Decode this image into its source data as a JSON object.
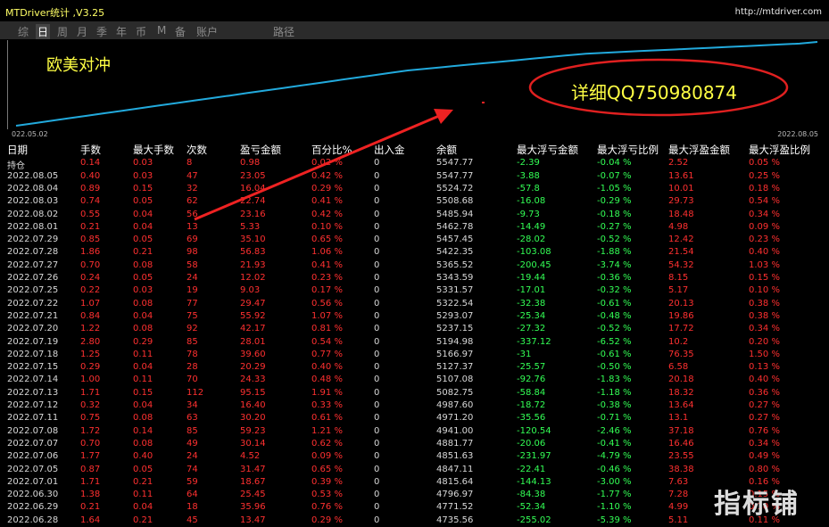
{
  "titlebar": {
    "title": "MTDriver统计 ,V3.25",
    "url": "http://mtdriver.com"
  },
  "nav": {
    "items": [
      "综",
      "日",
      "周",
      "月",
      "季",
      "年",
      "币",
      "M",
      "备",
      "账户",
      "路径"
    ],
    "active_index": 1
  },
  "chart": {
    "title": "欧美对冲",
    "ad_text": "详细QQ750980874",
    "date_start": "022.05.02",
    "date_end": "2022.08.05"
  },
  "chart_data": {
    "type": "line",
    "series": [
      {
        "values": [
          0.0,
          0.03,
          0.06,
          0.09,
          0.12,
          0.15,
          0.18,
          0.21,
          0.24,
          0.27,
          0.3,
          0.33,
          0.36,
          0.39,
          0.42,
          0.45,
          0.48,
          0.51,
          0.54,
          0.57,
          0.6,
          0.63,
          0.66,
          0.68,
          0.7,
          0.72,
          0.74,
          0.76,
          0.78,
          0.8,
          0.82,
          0.84,
          0.86,
          0.87,
          0.88,
          0.89,
          0.9,
          0.91,
          0.92,
          0.93,
          0.94,
          0.95,
          0.96,
          0.97,
          0.98,
          1.0
        ]
      }
    ],
    "line_color": "#22aadd"
  },
  "table": {
    "headers": [
      "日期",
      "手数",
      "最大手数",
      "次数",
      "盈亏金额",
      "百分比%",
      "出入金",
      "余额",
      "最大浮亏金额",
      "最大浮亏比例",
      "最大浮盈金额",
      "最大浮盈比例"
    ],
    "rows": [
      [
        "持仓",
        "0.14",
        "0.03",
        "8",
        "0.98",
        "0.02 %",
        "0",
        "5547.77",
        "-2.39",
        "-0.04 %",
        "2.52",
        "0.05 %"
      ],
      [
        "2022.08.05",
        "0.40",
        "0.03",
        "47",
        "23.05",
        "0.42 %",
        "0",
        "5547.77",
        "-3.88",
        "-0.07 %",
        "13.61",
        "0.25 %"
      ],
      [
        "2022.08.04",
        "0.89",
        "0.15",
        "32",
        "16.04",
        "0.29 %",
        "0",
        "5524.72",
        "-57.8",
        "-1.05 %",
        "10.01",
        "0.18 %"
      ],
      [
        "2022.08.03",
        "0.74",
        "0.05",
        "62",
        "22.74",
        "0.41 %",
        "0",
        "5508.68",
        "-16.08",
        "-0.29 %",
        "29.73",
        "0.54 %"
      ],
      [
        "2022.08.02",
        "0.55",
        "0.04",
        "56",
        "23.16",
        "0.42 %",
        "0",
        "5485.94",
        "-9.73",
        "-0.18 %",
        "18.48",
        "0.34 %"
      ],
      [
        "2022.08.01",
        "0.21",
        "0.04",
        "13",
        "5.33",
        "0.10 %",
        "0",
        "5462.78",
        "-14.49",
        "-0.27 %",
        "4.98",
        "0.09 %"
      ],
      [
        "2022.07.29",
        "0.85",
        "0.05",
        "69",
        "35.10",
        "0.65 %",
        "0",
        "5457.45",
        "-28.02",
        "-0.52 %",
        "12.42",
        "0.23 %"
      ],
      [
        "2022.07.28",
        "1.86",
        "0.21",
        "98",
        "56.83",
        "1.06 %",
        "0",
        "5422.35",
        "-103.08",
        "-1.88 %",
        "21.54",
        "0.40 %"
      ],
      [
        "2022.07.27",
        "0.70",
        "0.08",
        "58",
        "21.93",
        "0.41 %",
        "0",
        "5365.52",
        "-200.45",
        "-3.74 %",
        "54.32",
        "1.03 %"
      ],
      [
        "2022.07.26",
        "0.24",
        "0.05",
        "24",
        "12.02",
        "0.23 %",
        "0",
        "5343.59",
        "-19.44",
        "-0.36 %",
        "8.15",
        "0.15 %"
      ],
      [
        "2022.07.25",
        "0.22",
        "0.03",
        "19",
        "9.03",
        "0.17 %",
        "0",
        "5331.57",
        "-17.01",
        "-0.32 %",
        "5.17",
        "0.10 %"
      ],
      [
        "2022.07.22",
        "1.07",
        "0.08",
        "77",
        "29.47",
        "0.56 %",
        "0",
        "5322.54",
        "-32.38",
        "-0.61 %",
        "20.13",
        "0.38 %"
      ],
      [
        "2022.07.21",
        "0.84",
        "0.04",
        "75",
        "55.92",
        "1.07 %",
        "0",
        "5293.07",
        "-25.34",
        "-0.48 %",
        "19.86",
        "0.38 %"
      ],
      [
        "2022.07.20",
        "1.22",
        "0.08",
        "92",
        "42.17",
        "0.81 %",
        "0",
        "5237.15",
        "-27.32",
        "-0.52 %",
        "17.72",
        "0.34 %"
      ],
      [
        "2022.07.19",
        "2.80",
        "0.29",
        "85",
        "28.01",
        "0.54 %",
        "0",
        "5194.98",
        "-337.12",
        "-6.52 %",
        "10.2",
        "0.20 %"
      ],
      [
        "2022.07.18",
        "1.25",
        "0.11",
        "78",
        "39.60",
        "0.77 %",
        "0",
        "5166.97",
        "-31",
        "-0.61 %",
        "76.35",
        "1.50 %"
      ],
      [
        "2022.07.15",
        "0.29",
        "0.04",
        "28",
        "20.29",
        "0.40 %",
        "0",
        "5127.37",
        "-25.57",
        "-0.50 %",
        "6.58",
        "0.13 %"
      ],
      [
        "2022.07.14",
        "1.00",
        "0.11",
        "70",
        "24.33",
        "0.48 %",
        "0",
        "5107.08",
        "-92.76",
        "-1.83 %",
        "20.18",
        "0.40 %"
      ],
      [
        "2022.07.13",
        "1.71",
        "0.15",
        "112",
        "95.15",
        "1.91 %",
        "0",
        "5082.75",
        "-58.84",
        "-1.18 %",
        "18.32",
        "0.36 %"
      ],
      [
        "2022.07.12",
        "0.32",
        "0.04",
        "34",
        "16.40",
        "0.33 %",
        "0",
        "4987.60",
        "-18.72",
        "-0.38 %",
        "13.64",
        "0.27 %"
      ],
      [
        "2022.07.11",
        "0.75",
        "0.08",
        "63",
        "30.20",
        "0.61 %",
        "0",
        "4971.20",
        "-35.56",
        "-0.71 %",
        "13.1",
        "0.27 %"
      ],
      [
        "2022.07.08",
        "1.72",
        "0.14",
        "85",
        "59.23",
        "1.21 %",
        "0",
        "4941.00",
        "-120.54",
        "-2.46 %",
        "37.18",
        "0.76 %"
      ],
      [
        "2022.07.07",
        "0.70",
        "0.08",
        "49",
        "30.14",
        "0.62 %",
        "0",
        "4881.77",
        "-20.06",
        "-0.41 %",
        "16.46",
        "0.34 %"
      ],
      [
        "2022.07.06",
        "1.77",
        "0.40",
        "24",
        "4.52",
        "0.09 %",
        "0",
        "4851.63",
        "-231.97",
        "-4.79 %",
        "23.55",
        "0.49 %"
      ],
      [
        "2022.07.05",
        "0.87",
        "0.05",
        "74",
        "31.47",
        "0.65 %",
        "0",
        "4847.11",
        "-22.41",
        "-0.46 %",
        "38.38",
        "0.80 %"
      ],
      [
        "2022.07.01",
        "1.71",
        "0.21",
        "59",
        "18.67",
        "0.39 %",
        "0",
        "4815.64",
        "-144.13",
        "-3.00 %",
        "7.63",
        "0.16 %"
      ],
      [
        "2022.06.30",
        "1.38",
        "0.11",
        "64",
        "25.45",
        "0.53 %",
        "0",
        "4796.97",
        "-84.38",
        "-1.77 %",
        "7.28",
        "0.15 %"
      ],
      [
        "2022.06.29",
        "0.21",
        "0.04",
        "18",
        "35.96",
        "0.76 %",
        "0",
        "4771.52",
        "-52.34",
        "-1.10 %",
        "4.99",
        "0.10 %"
      ],
      [
        "2022.06.28",
        "1.64",
        "0.21",
        "45",
        "13.47",
        "0.29 %",
        "0",
        "4735.56",
        "-255.02",
        "-5.39 %",
        "5.11",
        "0.11 %"
      ]
    ]
  },
  "watermark": "指标铺",
  "colors": {
    "positive": "#ff3030",
    "negative": "#33ff55",
    "neutral": "#d8d8d8",
    "accent_yellow": "#ffff44",
    "ellipse": "#e02020",
    "arrow": "#ee2222"
  }
}
